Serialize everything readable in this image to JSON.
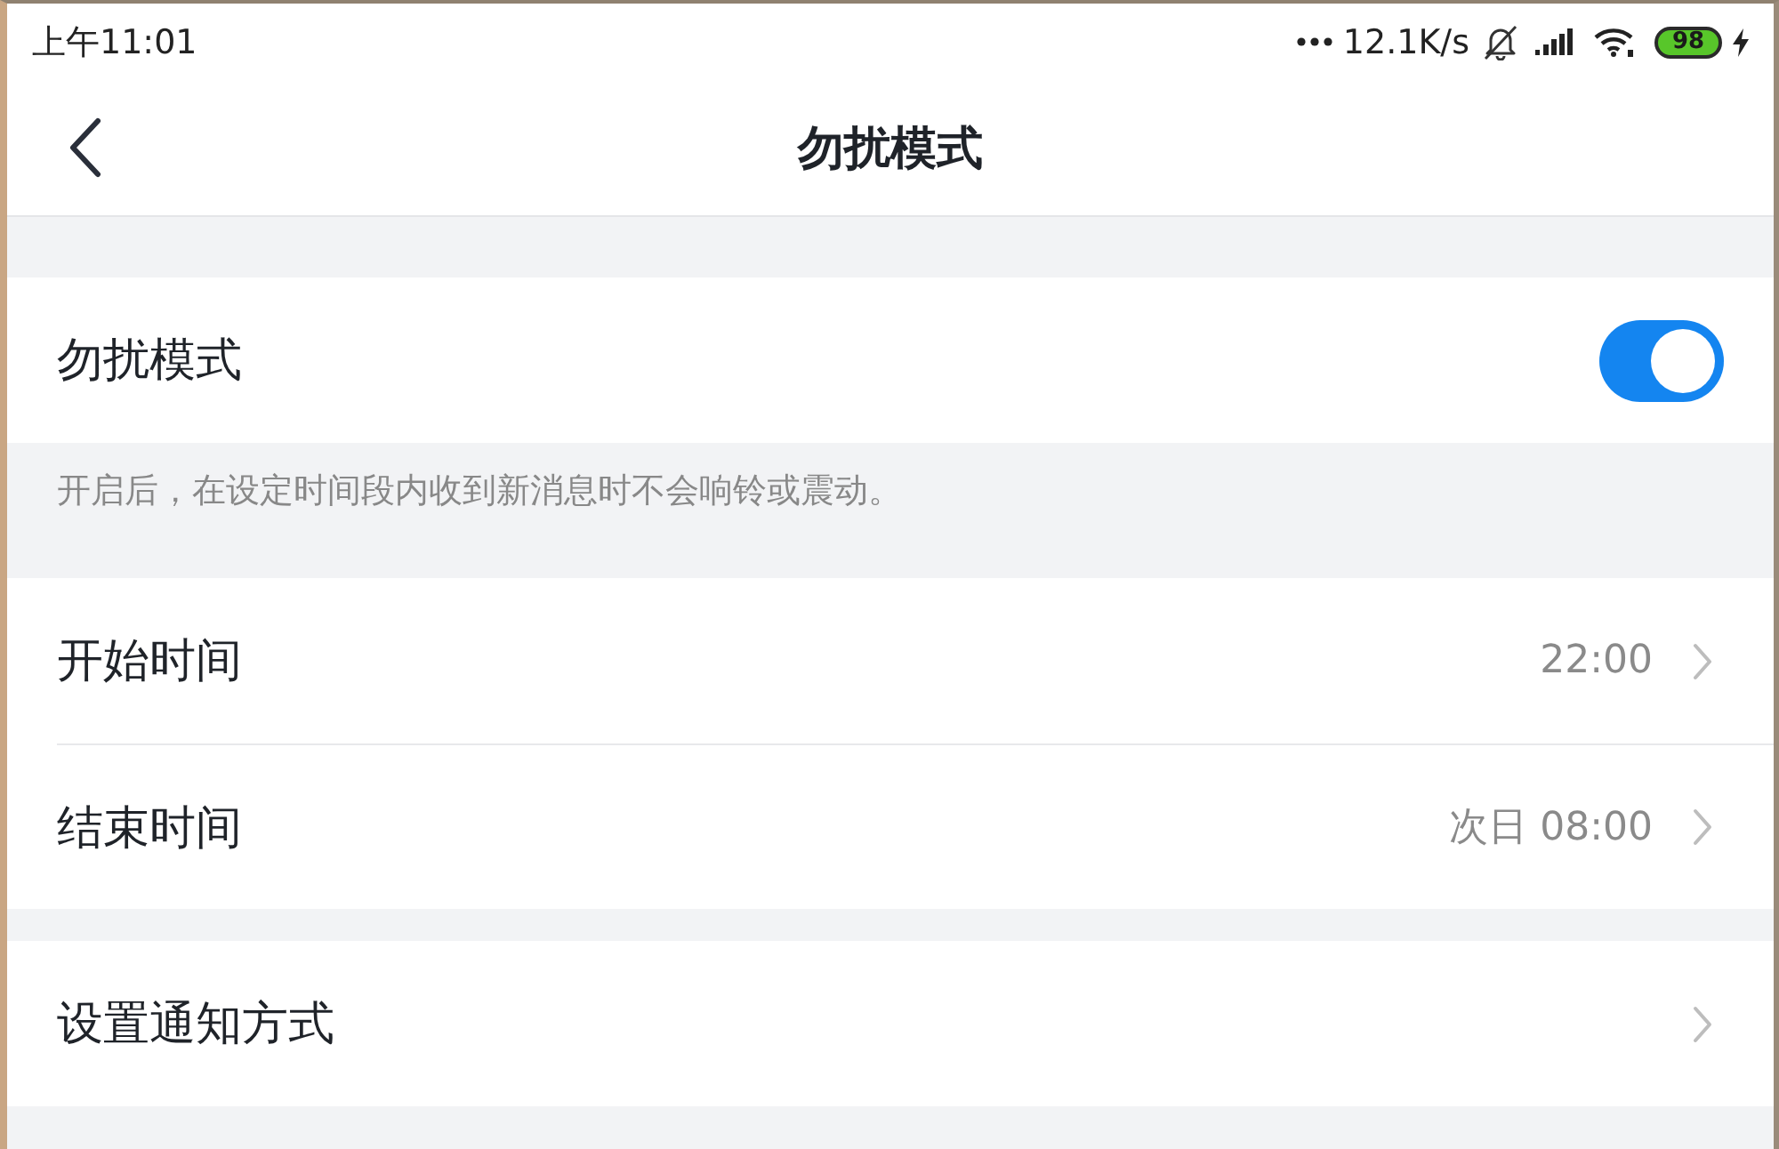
{
  "status_bar": {
    "time": "上午11:01",
    "network_speed": "12.1K/s",
    "battery": "98"
  },
  "nav_bar": {
    "title": "勿扰模式"
  },
  "sections": [
    {
      "rows": [
        {
          "kind": "toggle",
          "label": "勿扰模式",
          "on": true
        }
      ],
      "note": "开启后，在设定时间段内收到新消息时不会响铃或震动。"
    },
    {
      "rows": [
        {
          "kind": "link",
          "label": "开始时间",
          "value": "22:00"
        },
        {
          "kind": "link",
          "label": "结束时间",
          "value": "次日 08:00"
        }
      ]
    },
    {
      "rows": [
        {
          "kind": "link",
          "label": "设置通知方式"
        }
      ]
    }
  ]
}
